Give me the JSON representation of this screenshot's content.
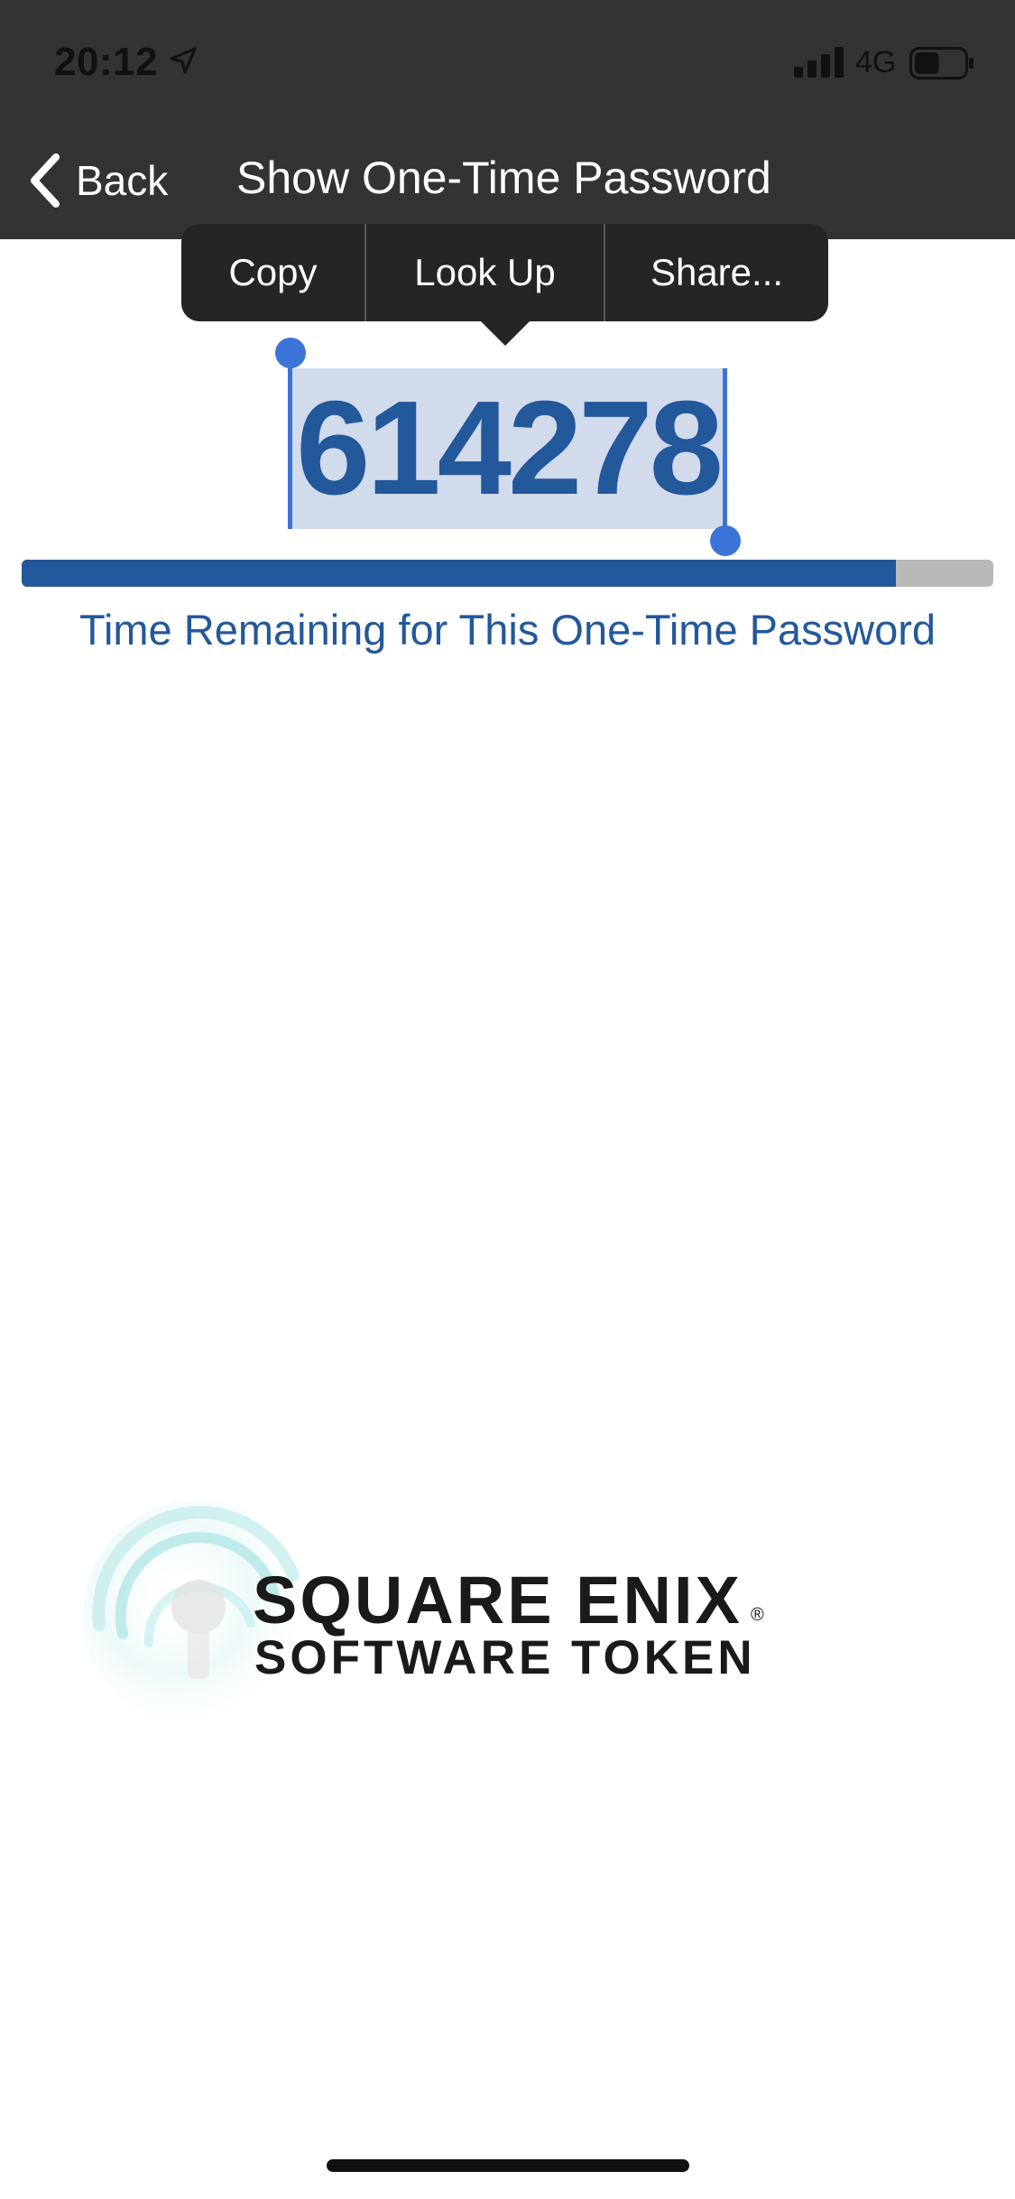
{
  "status_bar": {
    "time": "20:12",
    "network": "4G",
    "battery_level": 0.5
  },
  "nav": {
    "back_label": "Back",
    "title": "Show One-Time Password"
  },
  "edit_menu": {
    "copy_label": "Copy",
    "lookup_label": "Look Up",
    "share_label": "Share..."
  },
  "otp": {
    "code": "614278",
    "time_remaining_fraction": 0.9,
    "time_remaining_label": "Time Remaining for This One-Time Password"
  },
  "logo": {
    "line1": "SQUARE ENIX",
    "line2": "SOFTWARE TOKEN",
    "registered_mark": "®"
  },
  "colors": {
    "header_bg": "#333333",
    "accent_blue": "#23589b",
    "selection_blue": "#3c74d7",
    "selection_fill": "#d1dbec",
    "progress_track": "#b9b9b9",
    "logo_red": "#d4202a",
    "emblem_teal": "#9fe0e0"
  },
  "icons": {
    "location": "location-arrow-icon",
    "signal": "signal-bars-icon",
    "battery": "battery-icon",
    "back": "chevron-left-icon",
    "emblem": "key-emblem-icon"
  }
}
